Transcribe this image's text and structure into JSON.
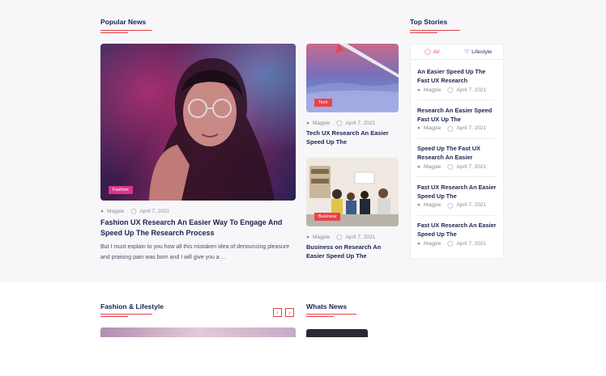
{
  "popular": {
    "heading": "Popular News",
    "main": {
      "badge": "Fashion",
      "author": "Magpie",
      "date": "April 7, 2021",
      "title": "Fashion UX Research An Easier Way To Engage And Speed Up The Research Process",
      "excerpt": "But I must explain to you how all this mistaken idea of denouncing pleasure and praising pain was born and I will give you a ..."
    },
    "side": [
      {
        "badge": "Tech",
        "author": "Magpie",
        "date": "April 7, 2021",
        "title": "Tech UX Research An Easier Speed Up The"
      },
      {
        "badge": "Business",
        "author": "Magpie",
        "date": "April 7, 2021",
        "title": "Business on Research An Easier Speed Up The"
      }
    ]
  },
  "top_stories": {
    "heading": "Top Stories",
    "tabs": [
      {
        "label": "All",
        "icon": "clock-icon"
      },
      {
        "label": "Lifestyle",
        "icon": "heart-icon"
      }
    ],
    "items": [
      {
        "title": "An Easier Speed Up The Fast UX Research",
        "author": "Magpie",
        "date": "April 7, 2021"
      },
      {
        "title": "Research An Easier Speed Fast UX Up The",
        "author": "Magpie",
        "date": "April 7, 2021"
      },
      {
        "title": "Speed Up The Fast UX Research An Easier",
        "author": "Magpie",
        "date": "April 7, 2021"
      },
      {
        "title": "Fast UX Research An Easier Speed Up The",
        "author": "Magpie",
        "date": "April 7, 2021"
      },
      {
        "title": "Fast UX Research An Easier Speed Up The",
        "author": "Magpie",
        "date": "April 7, 2021"
      }
    ]
  },
  "fashion": {
    "heading": "Fashion & Lifestyle",
    "prev": "‹",
    "next": "›"
  },
  "whats": {
    "heading": "Whats News"
  },
  "colors": {
    "accent": "#e8434a",
    "fashion_badge": "#e0338a",
    "navy": "#1b2350"
  }
}
